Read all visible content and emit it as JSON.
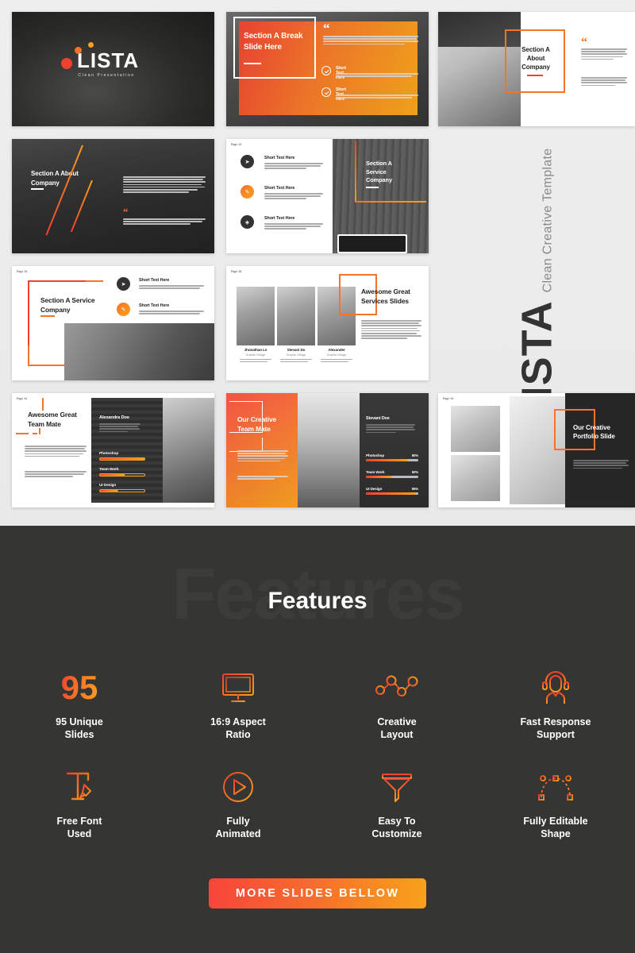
{
  "product": {
    "name": "LISTA",
    "tagline": "Clean Presentation",
    "vertical_name": "LISTA",
    "vertical_sub": "Clean Creative Template"
  },
  "slides": [
    {
      "id": "cover",
      "page_label": "",
      "title": "LISTA",
      "subtitle": "Clean Presentation"
    },
    {
      "id": "break-slide",
      "page_label": "",
      "title": "Section A Break Slide Here",
      "quote_glyph": "“",
      "items": [
        {
          "heading": "Short Text Here"
        },
        {
          "heading": "Short Text Here"
        }
      ]
    },
    {
      "id": "about-company-1",
      "page_label": "",
      "title": "Section A About Company",
      "quote_glyph": "“"
    },
    {
      "id": "about-company-2",
      "page_label": "",
      "title": "Section A About Company",
      "quote_glyph": "“"
    },
    {
      "id": "service-company-1",
      "page_label": "Page 14",
      "title": "Section A Service Company",
      "items": [
        {
          "heading": "Short Text Here"
        },
        {
          "heading": "Short Text Here"
        },
        {
          "heading": "Short Text Here"
        }
      ]
    },
    {
      "id": "service-company-2",
      "page_label": "Page 15",
      "title": "Section A Service Company",
      "items": [
        {
          "heading": "Short Text Here"
        },
        {
          "heading": "Short Text Here"
        }
      ]
    },
    {
      "id": "services-team",
      "page_label": "Page 28",
      "title": "Awesome Great Services Slides",
      "people": [
        {
          "name": "Jhonathan Le",
          "role": "Graphic Design"
        },
        {
          "name": "Stevani Do",
          "role": "Graphic Design"
        },
        {
          "name": "Alexander",
          "role": "Graphic Design"
        }
      ]
    },
    {
      "id": "team-mate-1",
      "page_label": "Page 32",
      "title": "Awesome Great Team Mate",
      "person_name": "Alexandra Doe",
      "skills": [
        {
          "label": "Photoshop"
        },
        {
          "label": "Team Work"
        },
        {
          "label": "UI Design"
        }
      ]
    },
    {
      "id": "team-mate-2",
      "page_label": "",
      "title": "Our Creative Team Mate",
      "person_name": "Stevani Doe",
      "skills": [
        {
          "label": "Photoshop",
          "value": "80%",
          "pct": 80
        },
        {
          "label": "Team Work",
          "value": "50%",
          "pct": 50
        },
        {
          "label": "UI Design",
          "value": "95%",
          "pct": 95
        }
      ]
    },
    {
      "id": "portfolio",
      "page_label": "Page 34",
      "title": "Our Creative Portfolio Slide"
    }
  ],
  "features_section": {
    "ghost_text": "Features",
    "title": "Features",
    "items": [
      {
        "icon": "number-95-icon",
        "number": "95",
        "label": "95 Unique\nSlides",
        "label_l1": "95 Unique",
        "label_l2": "Slides"
      },
      {
        "icon": "monitor-icon",
        "label_l1": "16:9 Aspect",
        "label_l2": "Ratio"
      },
      {
        "icon": "network-nodes-icon",
        "label_l1": "Creative",
        "label_l2": "Layout"
      },
      {
        "icon": "headset-support-icon",
        "label_l1": "Fast Response",
        "label_l2": "Support"
      },
      {
        "icon": "font-type-tool-icon",
        "label_l1": "Free Font",
        "label_l2": "Used"
      },
      {
        "icon": "play-circle-icon",
        "label_l1": "Fully",
        "label_l2": "Animated"
      },
      {
        "icon": "funnel-icon",
        "label_l1": "Easy To",
        "label_l2": "Customize"
      },
      {
        "icon": "bezier-shape-icon",
        "label_l1": "Fully Editable",
        "label_l2": "Shape"
      }
    ],
    "cta_label": "MORE SLIDES BELLOW"
  },
  "colors": {
    "accent_red": "#f0402f",
    "accent_orange": "#f5732a",
    "accent_yellow": "#f9a01b",
    "dark_bg": "#353533",
    "light_bg": "#ececec"
  }
}
